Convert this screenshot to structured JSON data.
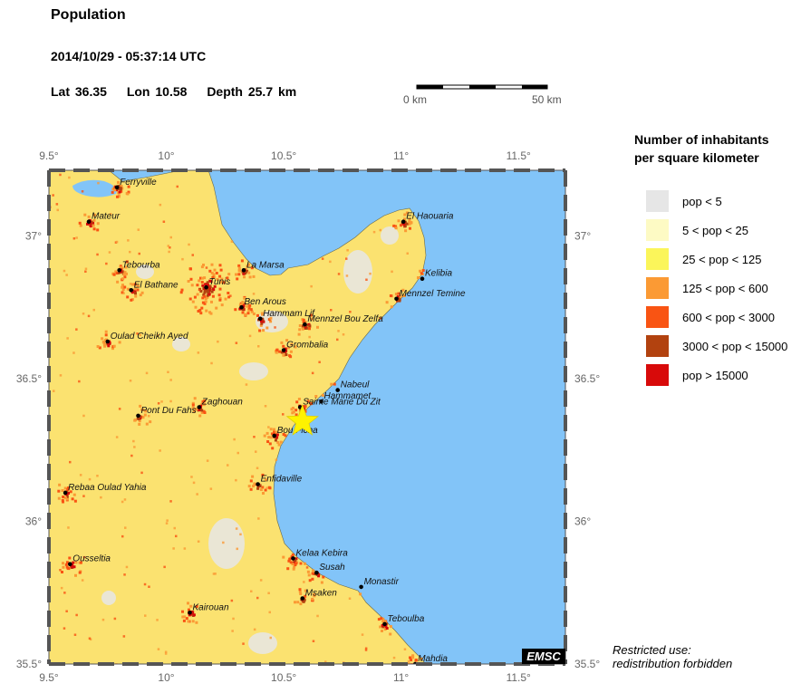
{
  "header": {
    "title": "Population",
    "datetime": "2014/10/29 - 05:37:14 UTC",
    "lat": "Lat 36.35",
    "lon": "Lon  10.58",
    "depth": "Depth  25.7 km"
  },
  "scale_bar": {
    "left_label": "0 km",
    "right_label": "50 km"
  },
  "axes": {
    "x_ticks": [
      "9.5°",
      "10°",
      "10.5°",
      "11°",
      "11.5°"
    ],
    "y_ticks": [
      "37°",
      "36.5°",
      "36°",
      "35.5°"
    ]
  },
  "legend": {
    "title_line1": "Number of inhabitants",
    "title_line2": "per square kilometer",
    "items": [
      {
        "label": "pop < 5",
        "color": "#e6e6e6"
      },
      {
        "label": "5 < pop < 25",
        "color": "#fdfac4"
      },
      {
        "label": "25 < pop < 125",
        "color": "#fbf55a"
      },
      {
        "label": "125 < pop < 600",
        "color": "#fb9a34"
      },
      {
        "label": "600 < pop < 3000",
        "color": "#f95413"
      },
      {
        "label": "3000 < pop < 15000",
        "color": "#b2420f"
      },
      {
        "label": "pop > 15000",
        "color": "#d80a0a"
      }
    ]
  },
  "map": {
    "lon_range": [
      9.5,
      11.7
    ],
    "lat_range": [
      35.5,
      37.23
    ],
    "sea_color": "#82c4f8",
    "land_color": "#fbe270",
    "epicenter": {
      "lat": 36.35,
      "lon": 10.58
    },
    "cities": [
      {
        "name": "Ferryville",
        "lon": 9.79,
        "lat": 37.17
      },
      {
        "name": "Mateur",
        "lon": 9.67,
        "lat": 37.05
      },
      {
        "name": "El Haouaria",
        "lon": 11.01,
        "lat": 37.05
      },
      {
        "name": "La Marsa",
        "lon": 10.33,
        "lat": 36.88
      },
      {
        "name": "Tebourba",
        "lon": 9.8,
        "lat": 36.88
      },
      {
        "name": "Kelibia",
        "lon": 11.09,
        "lat": 36.85
      },
      {
        "name": "Tunis",
        "lon": 10.17,
        "lat": 36.82
      },
      {
        "name": "El Bathane",
        "lon": 9.85,
        "lat": 36.81
      },
      {
        "name": "Mennzel Temine",
        "lon": 10.98,
        "lat": 36.78
      },
      {
        "name": "Ben Arous",
        "lon": 10.32,
        "lat": 36.75
      },
      {
        "name": "Hammam Lif",
        "lon": 10.4,
        "lat": 36.71
      },
      {
        "name": "Mennzel Bou Zelfa",
        "lon": 10.59,
        "lat": 36.69
      },
      {
        "name": "Oulad Cheikh Ayed",
        "lon": 9.75,
        "lat": 36.63
      },
      {
        "name": "Grombalia",
        "lon": 10.5,
        "lat": 36.6
      },
      {
        "name": "Nabeul",
        "lon": 10.73,
        "lat": 36.46
      },
      {
        "name": "Sainte Marie Du Zit",
        "lon": 10.57,
        "lat": 36.4
      },
      {
        "name": "Hammamet",
        "lon": 10.66,
        "lat": 36.42
      },
      {
        "name": "Zaghouan",
        "lon": 10.14,
        "lat": 36.4
      },
      {
        "name": "Pont Du Fahs",
        "lon": 9.88,
        "lat": 36.37
      },
      {
        "name": "Bou Ficha",
        "lon": 10.46,
        "lat": 36.3
      },
      {
        "name": "Enfidaville",
        "lon": 10.39,
        "lat": 36.13
      },
      {
        "name": "Rebaa Oulad Yahia",
        "lon": 9.57,
        "lat": 36.1
      },
      {
        "name": "Kelaa Kebira",
        "lon": 10.54,
        "lat": 35.87
      },
      {
        "name": "Ousseltia",
        "lon": 9.59,
        "lat": 35.85
      },
      {
        "name": "Susah",
        "lon": 10.64,
        "lat": 35.82
      },
      {
        "name": "Monastir",
        "lon": 10.83,
        "lat": 35.77
      },
      {
        "name": "Msaken",
        "lon": 10.58,
        "lat": 35.73
      },
      {
        "name": "Kairouan",
        "lon": 10.1,
        "lat": 35.68
      },
      {
        "name": "Teboulba",
        "lon": 10.93,
        "lat": 35.64
      },
      {
        "name": "Mahdia",
        "lon": 11.06,
        "lat": 35.5
      }
    ]
  },
  "logo": {
    "text": "EMSC"
  },
  "note": {
    "line1": "Restricted use:",
    "line2": "redistribution forbidden"
  }
}
